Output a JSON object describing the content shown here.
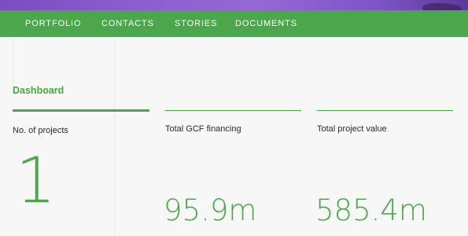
{
  "nav": {
    "items": [
      {
        "label": "PORTFOLIO"
      },
      {
        "label": "CONTACTS"
      },
      {
        "label": "STORIES"
      },
      {
        "label": "DOCUMENTS"
      }
    ]
  },
  "dashboard": {
    "tab_label": "Dashboard",
    "stats": [
      {
        "label": "No. of projects",
        "value": "1"
      },
      {
        "label": "Total GCF financing",
        "value": "95.9m"
      },
      {
        "label": "Total project value",
        "value": "585.4m"
      }
    ]
  },
  "colors": {
    "accent": "#4ca64c",
    "nav_text": "#ffffff",
    "background": "#f6f7f6",
    "hero": "#8a5fcf"
  }
}
